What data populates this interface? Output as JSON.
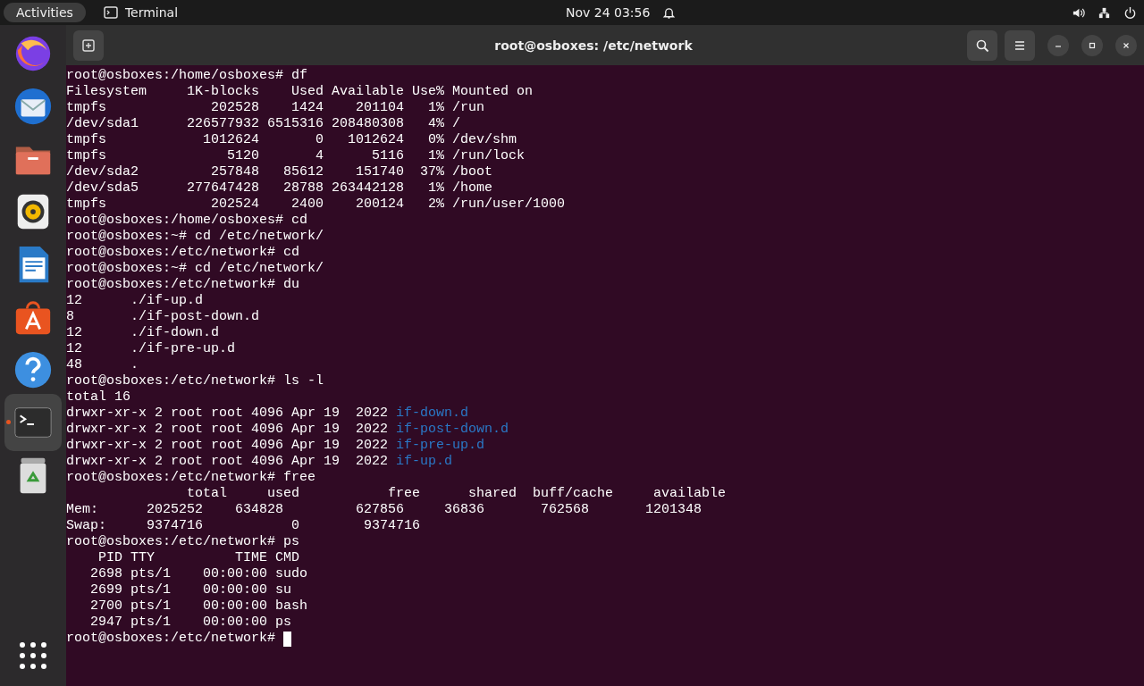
{
  "top_bar": {
    "activities": "Activities",
    "app_name": "Terminal",
    "clock": "Nov 24  03:56"
  },
  "dock": [
    {
      "kind": "firefox",
      "selected": false,
      "running": false
    },
    {
      "kind": "mail",
      "selected": false,
      "running": false
    },
    {
      "kind": "files",
      "selected": false,
      "running": false
    },
    {
      "kind": "music",
      "selected": false,
      "running": false
    },
    {
      "kind": "writer",
      "selected": false,
      "running": false
    },
    {
      "kind": "store",
      "selected": false,
      "running": false
    },
    {
      "kind": "help",
      "selected": false,
      "running": false
    },
    {
      "kind": "terminal",
      "selected": true,
      "running": true
    },
    {
      "kind": "trash",
      "selected": false,
      "running": false
    }
  ],
  "window": {
    "title": "root@osboxes: /etc/network"
  },
  "terminal": {
    "cursor": true,
    "lines": [
      {
        "text": "root@osboxes:/home/osboxes# df"
      },
      {
        "text": "Filesystem     1K-blocks    Used Available Use% Mounted on"
      },
      {
        "text": "tmpfs             202528    1424    201104   1% /run"
      },
      {
        "text": "/dev/sda1      226577932 6515316 208480308   4% /"
      },
      {
        "text": "tmpfs            1012624       0   1012624   0% /dev/shm"
      },
      {
        "text": "tmpfs               5120       4      5116   1% /run/lock"
      },
      {
        "text": "/dev/sda2         257848   85612    151740  37% /boot"
      },
      {
        "text": "/dev/sda5      277647428   28788 263442128   1% /home"
      },
      {
        "text": "tmpfs             202524    2400    200124   2% /run/user/1000"
      },
      {
        "text": "root@osboxes:/home/osboxes# cd"
      },
      {
        "text": "root@osboxes:~# cd /etc/network/"
      },
      {
        "text": "root@osboxes:/etc/network# cd"
      },
      {
        "text": "root@osboxes:~# cd /etc/network/"
      },
      {
        "text": "root@osboxes:/etc/network# du"
      },
      {
        "text": "12      ./if-up.d"
      },
      {
        "text": "8       ./if-post-down.d"
      },
      {
        "text": "12      ./if-down.d"
      },
      {
        "text": "12      ./if-pre-up.d"
      },
      {
        "text": "48      ."
      },
      {
        "text": "root@osboxes:/etc/network# ls -l"
      },
      {
        "text": "total 16"
      },
      {
        "text": "drwxr-xr-x 2 root root 4096 Apr 19  2022 ",
        "dir": "if-down.d"
      },
      {
        "text": "drwxr-xr-x 2 root root 4096 Apr 19  2022 ",
        "dir": "if-post-down.d"
      },
      {
        "text": "drwxr-xr-x 2 root root 4096 Apr 19  2022 ",
        "dir": "if-pre-up.d"
      },
      {
        "text": "drwxr-xr-x 2 root root 4096 Apr 19  2022 ",
        "dir": "if-up.d"
      },
      {
        "text": "root@osboxes:/etc/network# free"
      },
      {
        "text": "               total     used           free      shared  buff/cache     available"
      },
      {
        "text": "Mem:      2025252    634828         627856     36836       762568       1201348"
      },
      {
        "text": "Swap:     9374716           0        9374716"
      },
      {
        "text": "root@osboxes:/etc/network# ps"
      },
      {
        "text": "    PID TTY          TIME CMD"
      },
      {
        "text": "   2698 pts/1    00:00:00 sudo"
      },
      {
        "text": "   2699 pts/1    00:00:00 su"
      },
      {
        "text": "   2700 pts/1    00:00:00 bash"
      },
      {
        "text": "   2947 pts/1    00:00:00 ps"
      },
      {
        "text": "root@osboxes:/etc/network# "
      }
    ]
  }
}
